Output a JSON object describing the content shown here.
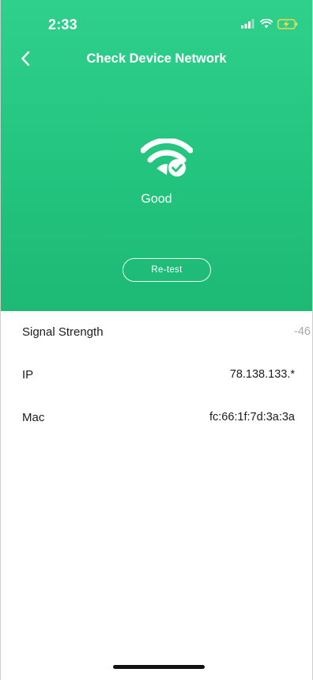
{
  "status_bar": {
    "time": "2:33"
  },
  "header": {
    "title": "Check Device Network",
    "back_icon": "chevron-left-icon"
  },
  "network": {
    "icon": "wifi-check-icon",
    "status": "Good",
    "retest_label": "Re-test"
  },
  "details": [
    {
      "label": "Signal Strength",
      "value": "-46"
    },
    {
      "label": "IP",
      "value": "78.138.133.*"
    },
    {
      "label": "Mac",
      "value": "fc:66:1f:7d:3a:3a"
    }
  ],
  "colors": {
    "accent": "#22c47e",
    "text": "#1c1c1c",
    "muted": "#a8a8a8"
  }
}
